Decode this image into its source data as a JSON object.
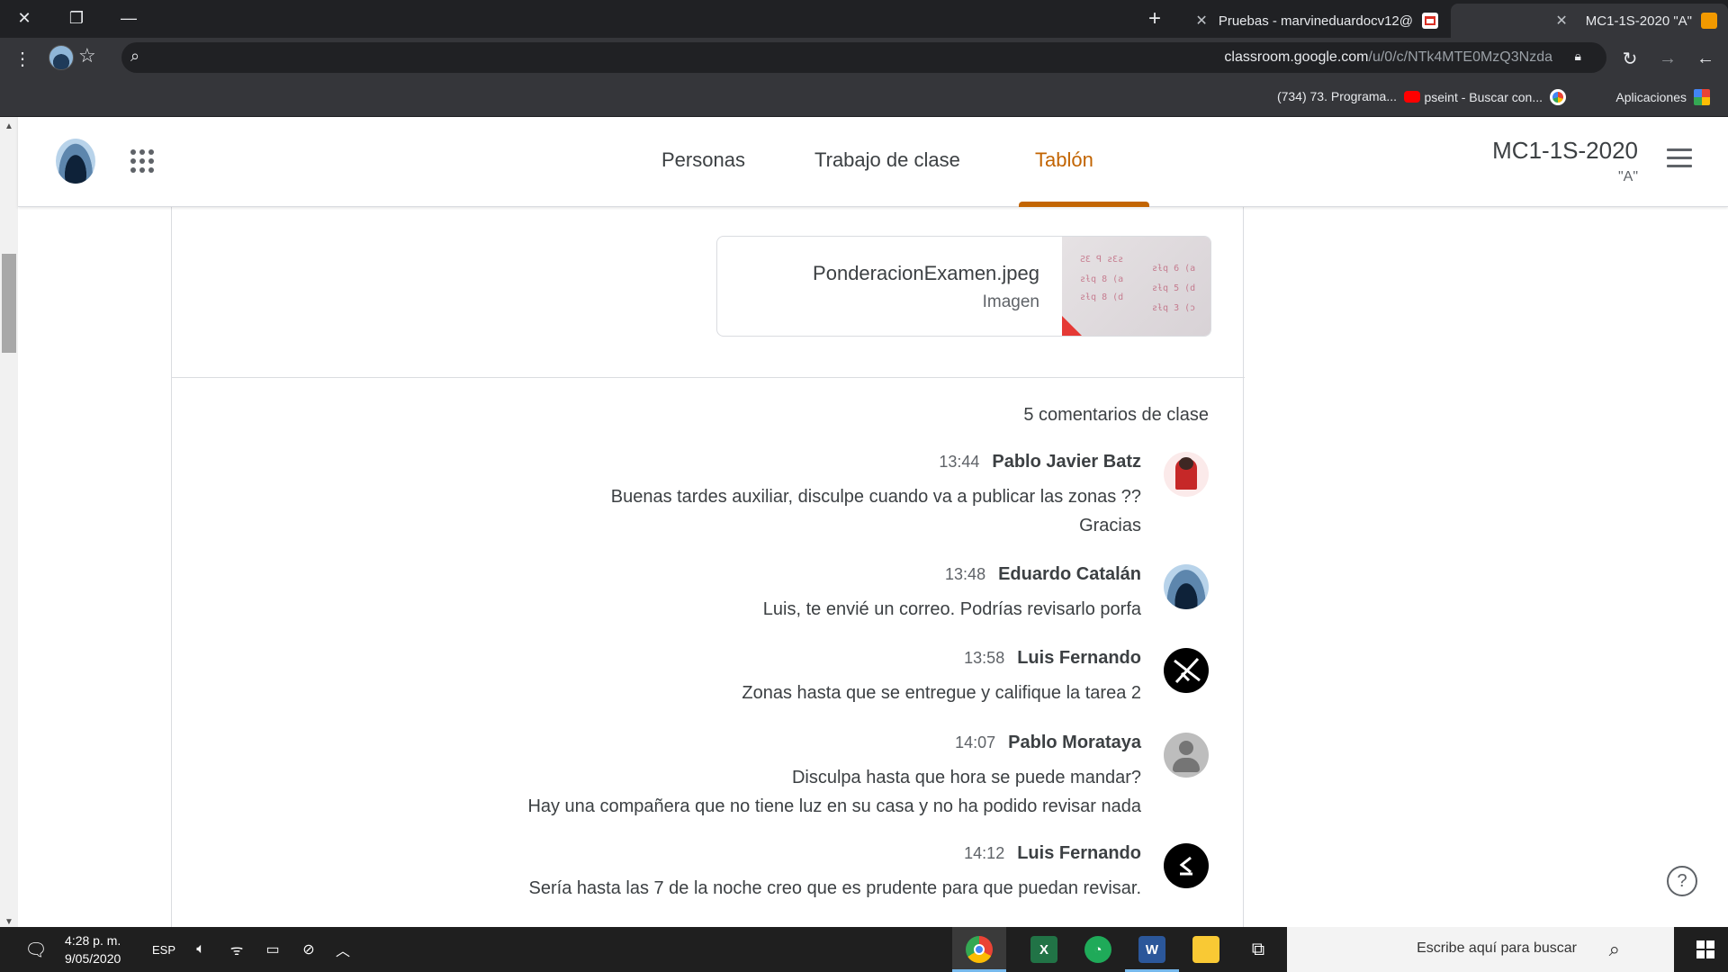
{
  "browser": {
    "tabs": [
      {
        "title": "MC1-1S-2020 \"A\"",
        "active": true
      },
      {
        "title": "Pruebas - marvineduardocv12@",
        "active": false
      }
    ],
    "url_host": "classroom.google.com",
    "url_path": "/u/0/c/NTk4MTE0MzQ3Nzda",
    "bookmarks": [
      {
        "label": "Aplicaciones"
      },
      {
        "label": "pseint - Buscar con..."
      },
      {
        "label": "(734) 73. Programa..."
      }
    ]
  },
  "classroom": {
    "class_name": "MC1-1S-2020",
    "section": "\"A\"",
    "tabs": {
      "stream": "Tablón",
      "classwork": "Trabajo de clase",
      "people": "Personas"
    },
    "attachment": {
      "name": "PonderacionExamen.jpeg",
      "type": "Imagen"
    },
    "comments_header": "5 comentarios de clase",
    "comments": [
      {
        "author": "Pablo Javier Batz",
        "time": "13:44",
        "lines": [
          "Buenas tardes auxiliar, disculpe cuando va a publicar las zonas ??",
          "Gracias"
        ]
      },
      {
        "author": "Eduardo Catalán",
        "time": "13:48",
        "lines": [
          "Luis, te envié un correo. Podrías revisarlo porfa"
        ]
      },
      {
        "author": "Luis Fernando",
        "time": "13:58",
        "lines": [
          "Zonas hasta que se entregue y califique la tarea 2"
        ]
      },
      {
        "author": "Pablo Morataya",
        "time": "14:07",
        "lines": [
          "Disculpa hasta que hora se puede mandar?",
          "Hay una compañera que no tiene luz en su casa y no ha podido revisar nada"
        ]
      },
      {
        "author": "Luis Fernando",
        "time": "14:12",
        "lines": [
          "Sería hasta las 7 de la noche creo que es prudente para que puedan revisar."
        ]
      }
    ]
  },
  "taskbar": {
    "search_placeholder": "Escribe aquí para buscar",
    "language": "ESP",
    "time": "4:28 p. m.",
    "date": "9/05/2020"
  },
  "colors": {
    "accent": "#c26401",
    "chrome_dark": "#202124",
    "chrome_toolbar": "#35363a"
  }
}
